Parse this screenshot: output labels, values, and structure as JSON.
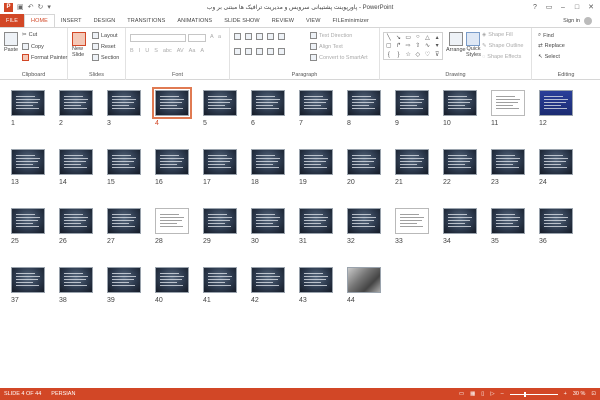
{
  "window": {
    "title": "پاورپوینت پشتیبانی سرویس و مدیریت ترافیک ها مبتنی بر وب - PowerPoint",
    "app_logo": "P",
    "controls": [
      "?",
      "▭",
      "–",
      "□",
      "✕"
    ]
  },
  "tabs": [
    {
      "label": "FILE",
      "type": "file"
    },
    {
      "label": "HOME",
      "type": "active"
    },
    {
      "label": "INSERT"
    },
    {
      "label": "DESIGN"
    },
    {
      "label": "TRANSITIONS"
    },
    {
      "label": "ANIMATIONS"
    },
    {
      "label": "SLIDE SHOW"
    },
    {
      "label": "REVIEW"
    },
    {
      "label": "VIEW"
    },
    {
      "label": "FILEminimizer"
    }
  ],
  "signin_label": "Sign in",
  "ribbon": {
    "clipboard": {
      "label": "Clipboard",
      "paste": "Paste",
      "cut": "Cut",
      "copy": "Copy",
      "format_painter": "Format Painter"
    },
    "slides": {
      "label": "Slides",
      "new_slide": "New",
      "new_slide_2": "Slide",
      "layout": "Layout",
      "reset": "Reset",
      "section": "Section"
    },
    "font": {
      "label": "Font"
    },
    "paragraph": {
      "label": "Paragraph",
      "text_direction": "Text Direction",
      "align_text": "Align Text",
      "convert_smartart": "Convert to SmartArt"
    },
    "drawing": {
      "label": "Drawing",
      "arrange": "Arrange",
      "quick_styles": "Quick",
      "quick_styles_2": "Styles",
      "shape_fill": "Shape Fill",
      "shape_outline": "Shape Outline",
      "shape_effects": "Shape Effects"
    },
    "editing": {
      "label": "Editing",
      "find": "Find",
      "replace": "Replace",
      "select": "Select"
    }
  },
  "slides": [
    {
      "n": "1"
    },
    {
      "n": "2"
    },
    {
      "n": "3"
    },
    {
      "n": "4",
      "selected": true
    },
    {
      "n": "5"
    },
    {
      "n": "6"
    },
    {
      "n": "7"
    },
    {
      "n": "8"
    },
    {
      "n": "9"
    },
    {
      "n": "10"
    },
    {
      "n": "11",
      "style": "light"
    },
    {
      "n": "12",
      "style": "blue"
    },
    {
      "n": "13"
    },
    {
      "n": "14"
    },
    {
      "n": "15"
    },
    {
      "n": "16"
    },
    {
      "n": "17"
    },
    {
      "n": "18"
    },
    {
      "n": "19"
    },
    {
      "n": "20"
    },
    {
      "n": "21"
    },
    {
      "n": "22"
    },
    {
      "n": "23"
    },
    {
      "n": "24"
    },
    {
      "n": "25"
    },
    {
      "n": "26"
    },
    {
      "n": "27"
    },
    {
      "n": "28",
      "style": "light"
    },
    {
      "n": "29"
    },
    {
      "n": "30"
    },
    {
      "n": "31"
    },
    {
      "n": "32"
    },
    {
      "n": "33",
      "style": "light"
    },
    {
      "n": "34"
    },
    {
      "n": "35"
    },
    {
      "n": "36"
    },
    {
      "n": "37"
    },
    {
      "n": "38"
    },
    {
      "n": "39"
    },
    {
      "n": "40"
    },
    {
      "n": "41"
    },
    {
      "n": "42"
    },
    {
      "n": "43"
    },
    {
      "n": "44",
      "style": "photo"
    }
  ],
  "status": {
    "slide_info": "SLIDE 4 OF 44",
    "language": "PERSIAN",
    "zoom_minus": "–",
    "zoom_plus": "+",
    "zoom_level": "30 %",
    "zoom_fraction": 0.3
  },
  "colors": {
    "accent": "#d24726",
    "selected_outline": "#e07a52"
  }
}
